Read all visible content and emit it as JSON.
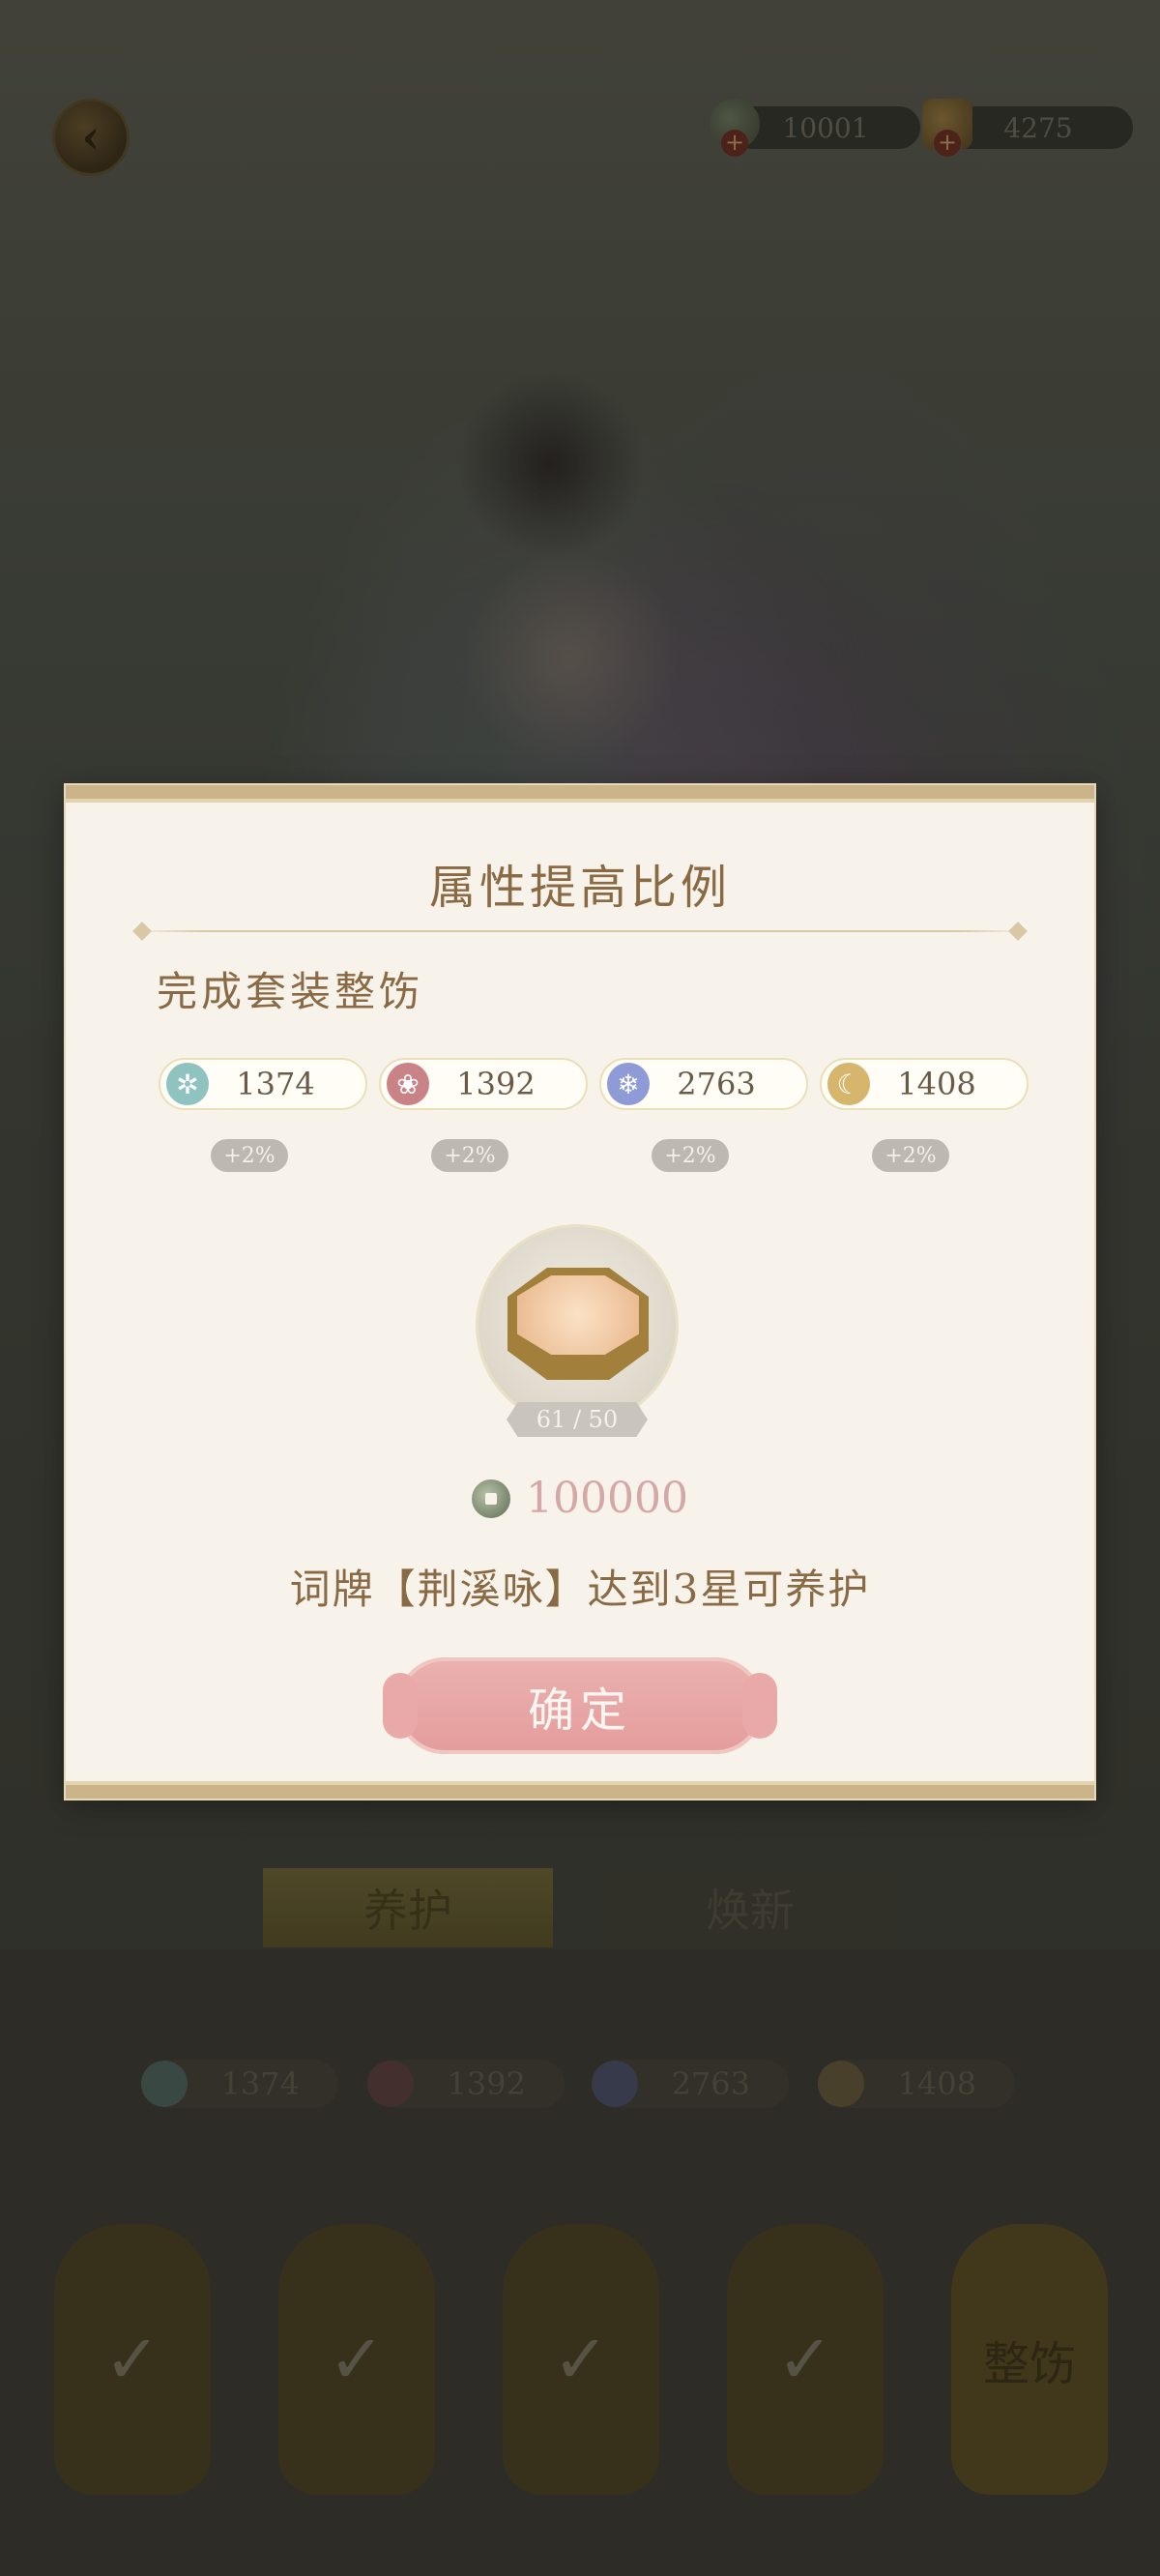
{
  "topbar": {
    "currency_jade": "10001",
    "currency_gold": "4275",
    "plus": "+"
  },
  "tabs": [
    {
      "label": "养护"
    },
    {
      "label": "焕新"
    }
  ],
  "stats": [
    "1374",
    "1392",
    "2763",
    "1408"
  ],
  "slots": [
    {
      "label": "整饬"
    }
  ],
  "modal": {
    "title": "属性提高比例",
    "subtitle": "完成套装整饬",
    "attributes": [
      {
        "value": "1374",
        "bonus": "+2%",
        "color": "#8fc3c0"
      },
      {
        "value": "1392",
        "bonus": "+2%",
        "color": "#c98285"
      },
      {
        "value": "2763",
        "bonus": "+2%",
        "color": "#8e9bd6"
      },
      {
        "value": "1408",
        "bonus": "+2%",
        "color": "#d6b56c"
      }
    ],
    "item_count": "61 / 50",
    "cost": "100000",
    "requirement": "词牌【荆溪咏】达到3星可养护",
    "confirm_label": "确定"
  }
}
